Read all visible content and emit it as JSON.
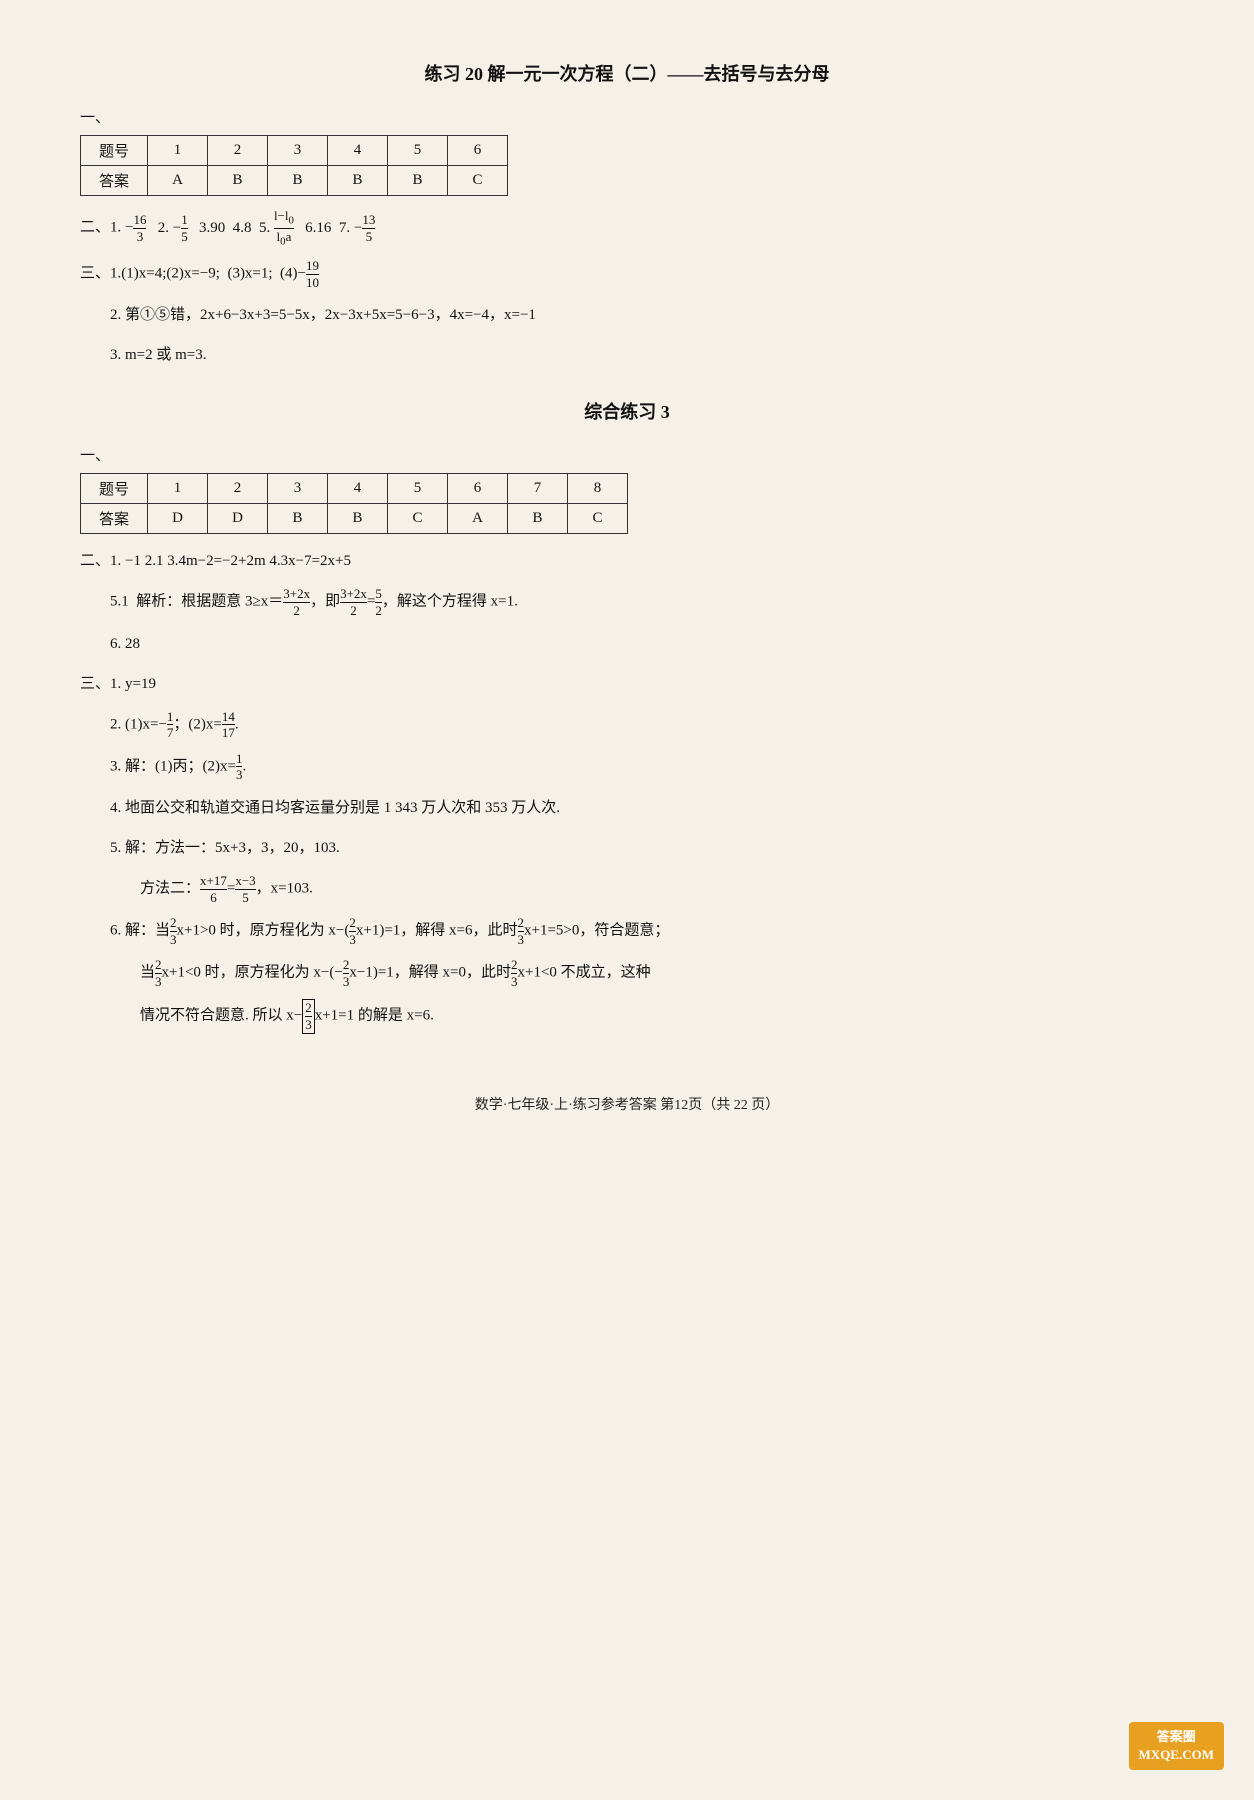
{
  "page": {
    "title1": "练习 20  解一元一次方程（二）——去括号与去分母",
    "section1_label": "一、",
    "table1": {
      "headers": [
        "题号",
        "1",
        "2",
        "3",
        "4",
        "5",
        "6"
      ],
      "rows": [
        [
          "答案",
          "A",
          "B",
          "B",
          "B",
          "B",
          "C"
        ]
      ]
    },
    "section2_answers": "二、1. −16/3  2. −1/5  3.90  4.8  5. (l−l₀)/(l₀a)  6.16  7. −13/5",
    "section3_label": "三、1.(1)x=4;(2)x=−9;  (3)x=1;  (4)−19/10",
    "section3_2": "2. 第①⑤错，2x+6−3x+3=5−5x，2x−3x+5x=5−6−3，4x=−4，x=−1",
    "section3_3": "3. m=2 或 m=3.",
    "title2": "综合练习 3",
    "section4_label": "一、",
    "table2": {
      "headers": [
        "题号",
        "1",
        "2",
        "3",
        "4",
        "5",
        "6",
        "7",
        "8"
      ],
      "rows": [
        [
          "答案",
          "D",
          "D",
          "B",
          "B",
          "C",
          "A",
          "B",
          "C"
        ]
      ]
    },
    "section5_answers": "二、1. −1  2.1  3.4m−2=−2+2m  4.3x−7=2x+5",
    "section5_5": "5.1  解析：根据题意 3≥x＝(3+2x)/2，即(3+2x)/2=5/2，解这个方程得 x=1.",
    "section5_6": "6. 28",
    "section6_label": "三、1. y=19",
    "section6_2": "2. (1)x=−1/7；(2)x=14/17.",
    "section6_3": "3. 解：(1)丙；(2)x=1/3.",
    "section6_4": "4. 地面公交和轨道交通日均客运量分别是 1 343 万人次和 353 万人次.",
    "section6_5": "5. 解：方法一：5x+3，3，20，103.",
    "section6_5b": "方法二：(x+17)/6=(x−3)/5，x=103.",
    "section6_6a": "6. 解：当2/3 x+1>0 时，原方程化为 x−(2/3 x+1)=1，解得 x=6，此时2/3 x+1=5>0，符合题意；",
    "section6_6b": "当2/3 x+1<0 时，原方程化为 x−(−2/3 x−1)=1，解得 x=0，此时2/3 x+1<0 不成立，这种",
    "section6_6c": "情况不符合题意. 所以 x−|2/3|x+1=1 的解是 x=6.",
    "footer": "数学·七年级·上·练习参考答案    第12页（共 22 页）",
    "watermark_line1": "答案圈",
    "watermark_line2": "MXQE.COM"
  }
}
